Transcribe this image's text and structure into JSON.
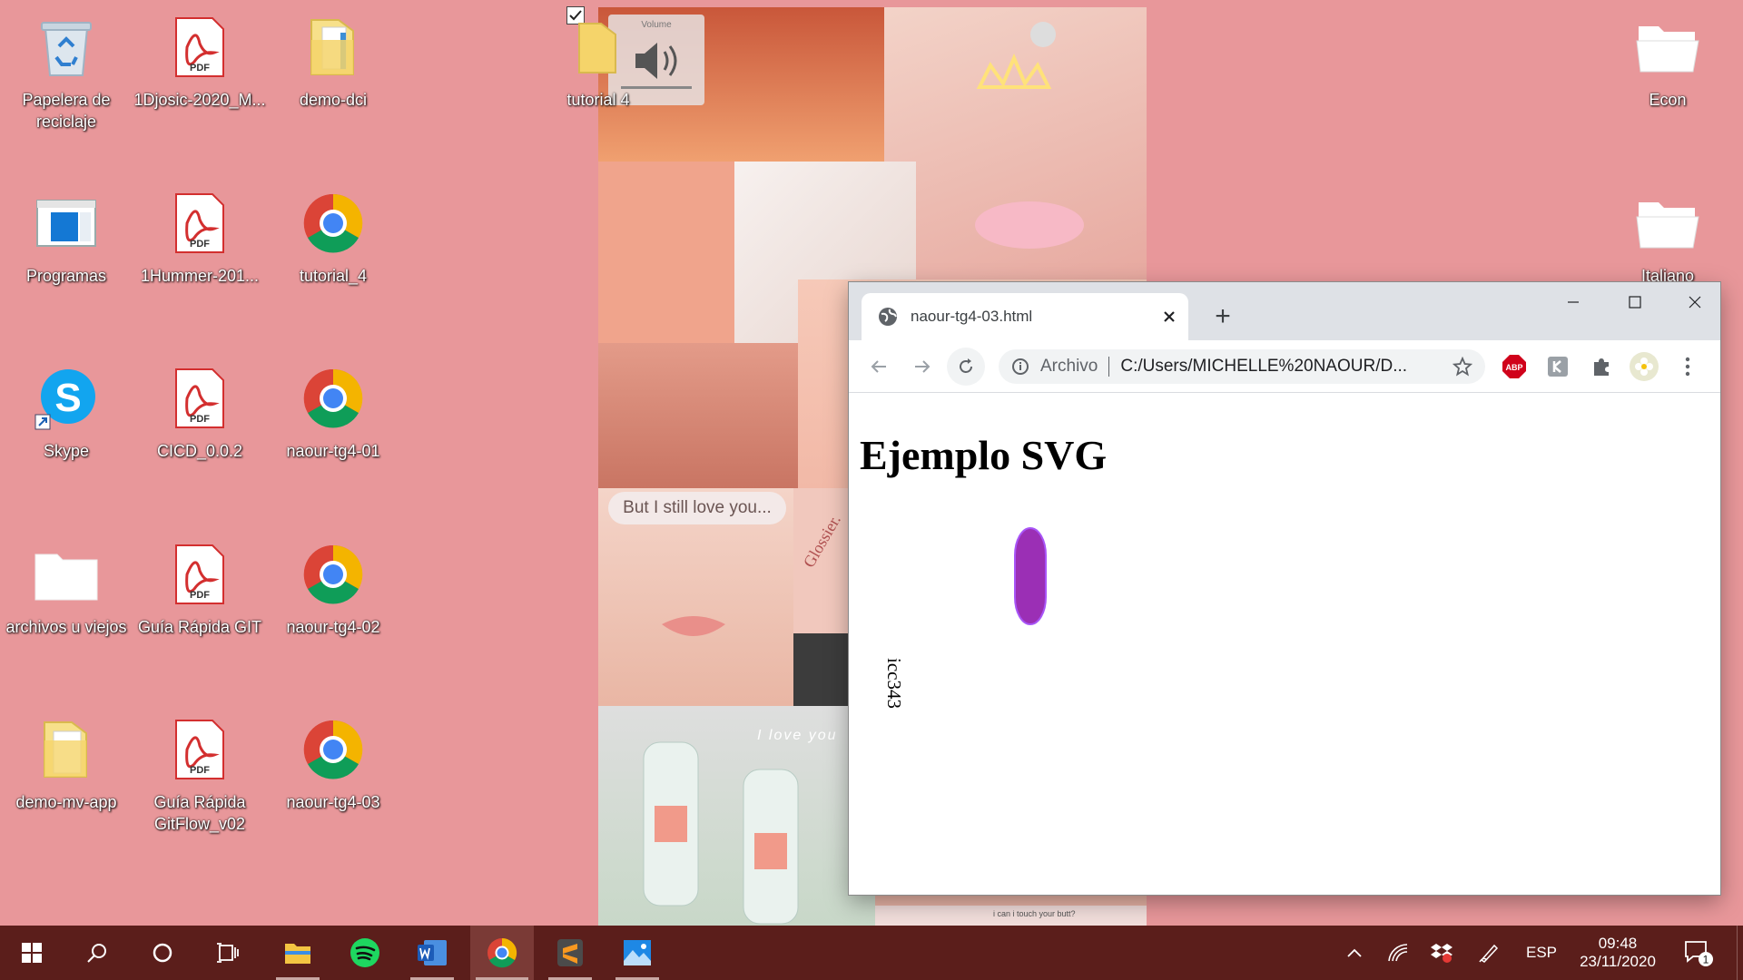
{
  "desktop": {
    "icons": [
      {
        "label": "Papelera de reciclaje",
        "icon": "recycle-bin-icon"
      },
      {
        "label": "1Djosic-2020_M...",
        "icon": "pdf-icon"
      },
      {
        "label": "demo-dci",
        "icon": "folder-icon"
      },
      {
        "label": "Programas",
        "icon": "window-icon"
      },
      {
        "label": "1Hummer-201...",
        "icon": "pdf-icon"
      },
      {
        "label": "tutorial_4",
        "icon": "chrome-icon"
      },
      {
        "label": "Skype",
        "icon": "skype-icon"
      },
      {
        "label": "CICD_0.0.2",
        "icon": "pdf-icon"
      },
      {
        "label": "naour-tg4-01",
        "icon": "chrome-icon"
      },
      {
        "label": "archivos u viejos",
        "icon": "folder-icon"
      },
      {
        "label": "Guía Rápida GIT",
        "icon": "pdf-icon"
      },
      {
        "label": "naour-tg4-02",
        "icon": "chrome-icon"
      },
      {
        "label": "demo-mv-app",
        "icon": "folder-icon"
      },
      {
        "label": "Guía Rápida GitFlow_v02",
        "icon": "pdf-icon"
      },
      {
        "label": "naour-tg4-03",
        "icon": "chrome-icon"
      },
      {
        "label": "tutorial 4",
        "icon": "folder-icon"
      },
      {
        "label": "Econ",
        "icon": "folder-open-icon"
      },
      {
        "label": "Italiano",
        "icon": "folder-open-icon"
      }
    ],
    "pdf_badge": "PDF",
    "volume_label": "Volume"
  },
  "wallpaper": {
    "speech_bubble": "But I still love you...",
    "lipstick_text": "Glossier.",
    "photo_text": "I love you",
    "note_text": "i can i touch your butt?"
  },
  "browser": {
    "tab_title": "naour-tg4-03.html",
    "new_tab": "+",
    "address_scheme": "Archivo",
    "address_url": "C:/Users/MICHELLE%20NAOUR/D...",
    "abp_label": "ABP",
    "page": {
      "heading": "Ejemplo SVG",
      "rotated_text": "icc343",
      "shape_color": "#9b2fb5",
      "shape_stroke": "#a855f7"
    }
  },
  "taskbar": {
    "lang": "ESP",
    "time": "09:48",
    "date": "23/11/2020",
    "notifications": "1",
    "apps": [
      "start-icon",
      "search-icon",
      "cortana-icon",
      "task-view-icon",
      "file-explorer-icon",
      "spotify-icon",
      "word-icon",
      "chrome-icon",
      "sublime-icon",
      "photos-icon"
    ]
  },
  "colors": {
    "desktop_bg": "#e8979a",
    "taskbar_bg": "#5b1e1b"
  }
}
